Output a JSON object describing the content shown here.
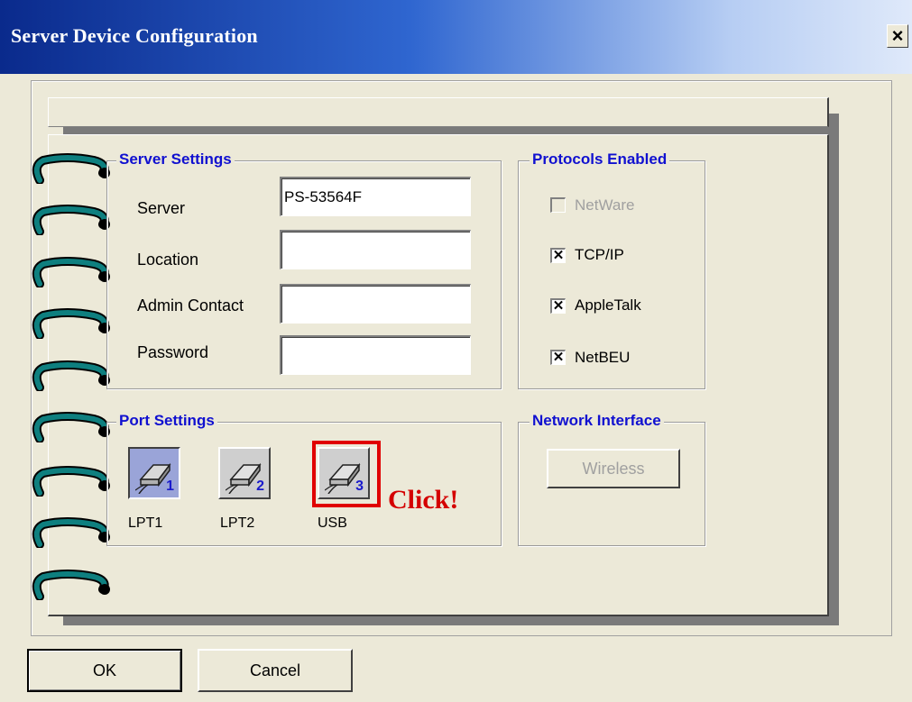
{
  "window": {
    "title": "Server Device Configuration",
    "close_glyph": "×"
  },
  "server_settings": {
    "title": "Server Settings",
    "fields": [
      {
        "label": "Server",
        "value": "PS-53564F"
      },
      {
        "label": "Location",
        "value": ""
      },
      {
        "label": "Admin Contact",
        "value": ""
      },
      {
        "label": "Password",
        "value": ""
      }
    ]
  },
  "protocols": {
    "title": "Protocols Enabled",
    "items": [
      {
        "label": "NetWare",
        "checked": false,
        "enabled": false
      },
      {
        "label": "TCP/IP",
        "checked": true,
        "enabled": true
      },
      {
        "label": "AppleTalk",
        "checked": true,
        "enabled": true
      },
      {
        "label": "NetBEU",
        "checked": true,
        "enabled": true
      }
    ]
  },
  "port_settings": {
    "title": "Port Settings",
    "ports": [
      {
        "label": "LPT1",
        "number": "1",
        "active": true,
        "highlighted": false
      },
      {
        "label": "LPT2",
        "number": "2",
        "active": false,
        "highlighted": false
      },
      {
        "label": "USB",
        "number": "3",
        "active": false,
        "highlighted": true
      }
    ],
    "annotation": "Click!"
  },
  "network_interface": {
    "title": "Network Interface",
    "button": {
      "label": "Wireless",
      "enabled": false
    }
  },
  "buttons": {
    "ok": "OK",
    "cancel": "Cancel"
  },
  "colors": {
    "group_title": "#1010d0",
    "ring": "#0e7f7f",
    "highlight": "#e00000",
    "annotation": "#d40000"
  }
}
